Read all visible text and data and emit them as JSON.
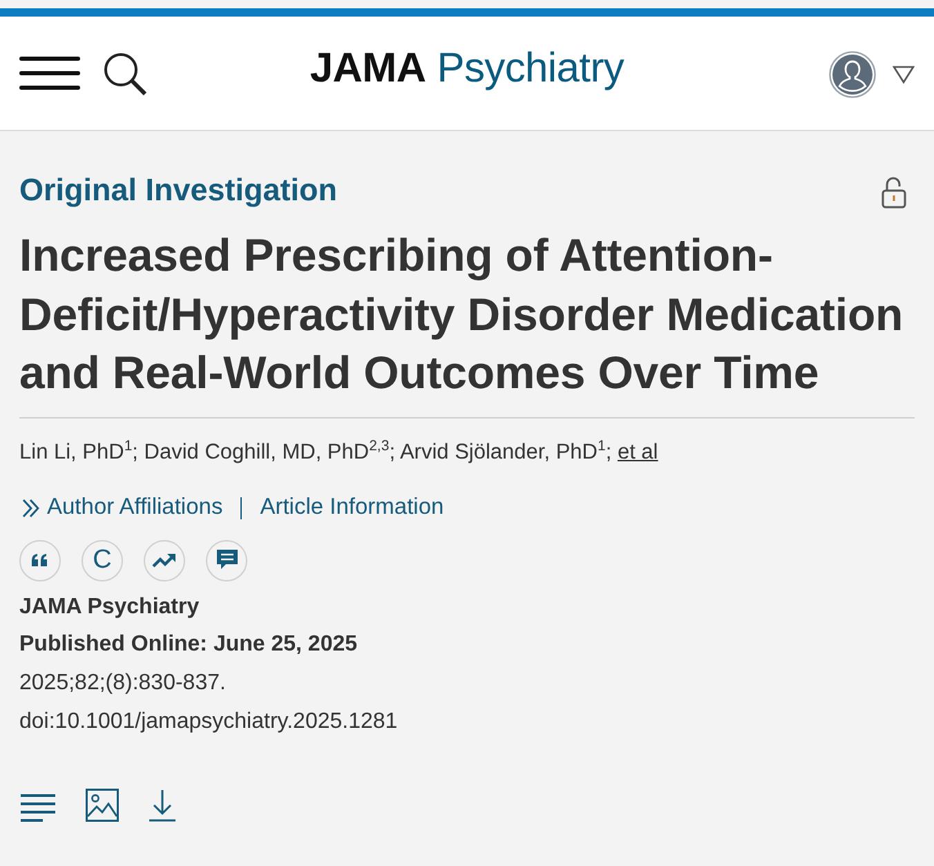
{
  "header": {
    "logo": {
      "brand": "JAMA",
      "journal": "Psychiatry"
    }
  },
  "article": {
    "section": "Original Investigation",
    "title": "Increased Prescribing of Attention-Deficit/Hyperactivity Disorder Medication and Real-World Outcomes Over Time",
    "authors": "Lin Li, PhD$^{1}$; David Coghill, MD, PhD$^{2,3}$; Arvid Sjölander, PhD$^{1}$;",
    "authors_link": "et al",
    "info_links": [
      "Author Affiliations",
      "Article Information"
    ],
    "tools": [
      {
        "kind": "quote"
      },
      {
        "kind": "letter",
        "label": "C"
      },
      {
        "kind": "trend"
      },
      {
        "kind": "comment"
      }
    ],
    "journal": "JAMA Psychiatry",
    "published": "Published Online: June 25, 2025",
    "citation": "2025;82;(8):830-837.",
    "doi": "doi:10.1001/jamapsychiatry.2025.1281",
    "views": [
      {
        "kind": "text"
      },
      {
        "kind": "figures"
      },
      {
        "kind": "download"
      }
    ]
  }
}
